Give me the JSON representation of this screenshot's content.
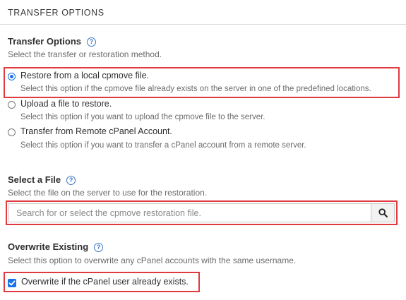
{
  "section": {
    "header": "TRANSFER OPTIONS"
  },
  "transfer": {
    "heading": "Transfer Options",
    "description": "Select the transfer or restoration method.",
    "options": [
      {
        "label": "Restore from a local cpmove file.",
        "description": "Select this option if the cpmove file already exists on the server in one of the predefined locations.",
        "selected": true
      },
      {
        "label": "Upload a file to restore.",
        "description": "Select this option if you want to upload the cpmove file to the server.",
        "selected": false
      },
      {
        "label": "Transfer from Remote cPanel Account.",
        "description": "Select this option if you want to transfer a cPanel account from a remote server.",
        "selected": false
      }
    ]
  },
  "file": {
    "heading": "Select a File",
    "description": "Select the file on the server to use for the restoration.",
    "search_placeholder": "Search for or select the cpmove restoration file."
  },
  "overwrite": {
    "heading": "Overwrite Existing",
    "description": "Select this option to overwrite any cPanel accounts with the same username.",
    "checkbox_label": "Overwrite if the cPanel user already exists.",
    "checked": true
  },
  "icons": {
    "help": "help-circle-icon",
    "search": "search-icon",
    "check": "check-icon"
  },
  "colors": {
    "accent": "#1a73e8",
    "highlight": "#e03a3e",
    "help": "#3a78c3"
  }
}
